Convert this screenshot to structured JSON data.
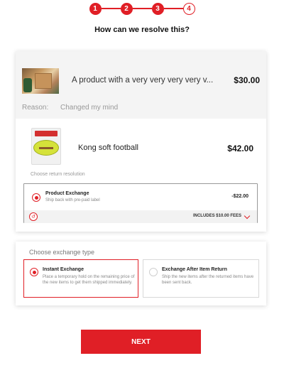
{
  "stepper": {
    "steps": [
      "1",
      "2",
      "3",
      "4"
    ]
  },
  "page": {
    "title": "How can we resolve this?"
  },
  "original_item": {
    "name": "A product with a very very very very v...",
    "price": "$30.00",
    "reason_label": "Reason:",
    "reason_value": "Changed my mind"
  },
  "return_item": {
    "name": "Kong soft football",
    "price": "$42.00",
    "choose_resolution_label": "Choose return resolution",
    "resolution": {
      "title": "Product Exchange",
      "subtitle": "Ship back with pre-paid label",
      "amount": "-$22.00",
      "fees_text": "INCLUDES $10.00 FEES"
    }
  },
  "exchange": {
    "label": "Choose exchange type",
    "options": [
      {
        "title": "Instant Exchange",
        "description": "Place a temporary hold on the remaining price of the new items to get them shipped immediately."
      },
      {
        "title": "Exchange After Item Return",
        "description": "Ship the new items after the returned items have been sent back."
      }
    ]
  },
  "actions": {
    "next_label": "NEXT"
  },
  "colors": {
    "accent": "#e01f26"
  }
}
